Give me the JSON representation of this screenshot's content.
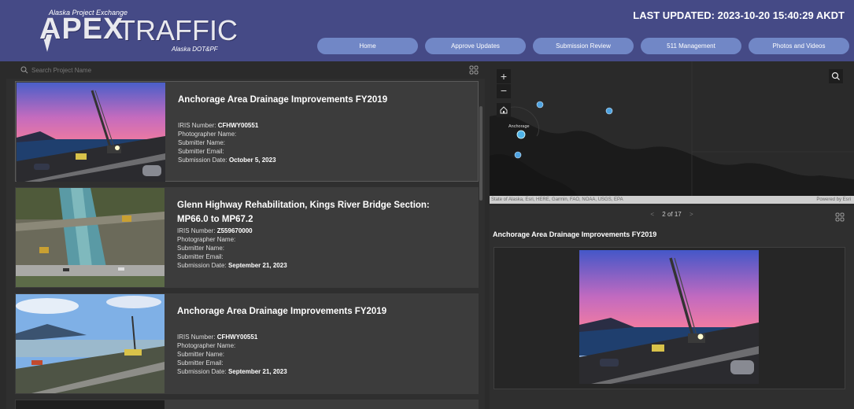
{
  "header": {
    "logo_top": "Alaska Project Exchange",
    "logo_apex": "APEX",
    "logo_traffic": "TRAFFIC",
    "logo_sub": "Alaska DOT&PF",
    "last_updated": "LAST UPDATED: 2023-10-20 15:40:29 AKDT",
    "bg_color": "#454a86",
    "nav_color": "#7187c6"
  },
  "nav": [
    "Home",
    "Approve Updates",
    "Submission Review",
    "511 Management",
    "Photos and Videos"
  ],
  "search": {
    "placeholder": "Search Project Name"
  },
  "cards": [
    {
      "title": "Anchorage Area Drainage Improvements FY2019",
      "iris_label": "IRIS Number:",
      "iris": "CFHWY00551",
      "photographer_label": "Photographer Name:",
      "submitter_name_label": "Submitter Name:",
      "submitter_email_label": "Submitter Email:",
      "date_label": "Submission Date:",
      "date": "October 5, 2023"
    },
    {
      "title": "Glenn Highway Rehabilitation, Kings River Bridge Section: MP66.0 to MP67.2",
      "iris_label": "IRIS Number:",
      "iris": "Z559670000",
      "photographer_label": "Photographer Name:",
      "submitter_name_label": "Submitter Name:",
      "submitter_email_label": "Submitter Email:",
      "date_label": "Submission Date:",
      "date": "September 21, 2023"
    },
    {
      "title": "Anchorage Area Drainage Improvements FY2019",
      "iris_label": "IRIS Number:",
      "iris": "CFHWY00551",
      "photographer_label": "Photographer Name:",
      "submitter_name_label": "Submitter Name:",
      "submitter_email_label": "Submitter Email:",
      "date_label": "Submission Date:",
      "date": "September 21, 2023"
    }
  ],
  "map": {
    "zoom_in": "+",
    "zoom_out": "−",
    "place_label": "Anchorage",
    "attribution": "State of Alaska, Esri, HERE, Garmin, FAO, NOAA, USGS, EPA",
    "powered_by": "Powered by Esri"
  },
  "detail": {
    "pager": "2 of 17",
    "prev": "<",
    "next": ">",
    "title": "Anchorage Area Drainage Improvements FY2019"
  }
}
